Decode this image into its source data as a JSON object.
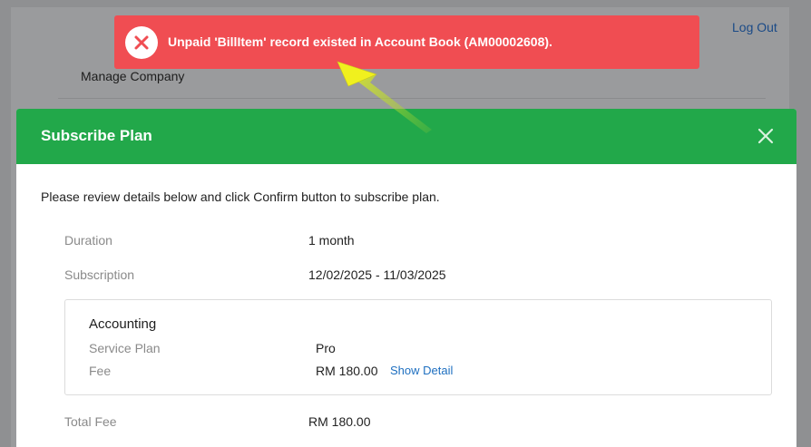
{
  "background": {
    "logout_label": "Log Out",
    "manage_company_label": "Manage Company"
  },
  "toast": {
    "message": "Unpaid 'BillItem' record existed in Account Book (AM00002608).",
    "icon": "error-x-icon",
    "color": "#f04d52"
  },
  "modal": {
    "title": "Subscribe Plan",
    "header_color": "#22a84a",
    "intro": "Please review details below and click Confirm button to subscribe plan.",
    "duration_label": "Duration",
    "duration_value": "1 month",
    "subscription_label": "Subscription",
    "subscription_value": "12/02/2025 - 11/03/2025",
    "card": {
      "title": "Accounting",
      "service_plan_label": "Service Plan",
      "service_plan_value": "Pro",
      "fee_label": "Fee",
      "fee_value": "RM 180.00",
      "show_detail_label": "Show Detail"
    },
    "total_fee_label": "Total Fee",
    "total_fee_value": "RM 180.00"
  }
}
